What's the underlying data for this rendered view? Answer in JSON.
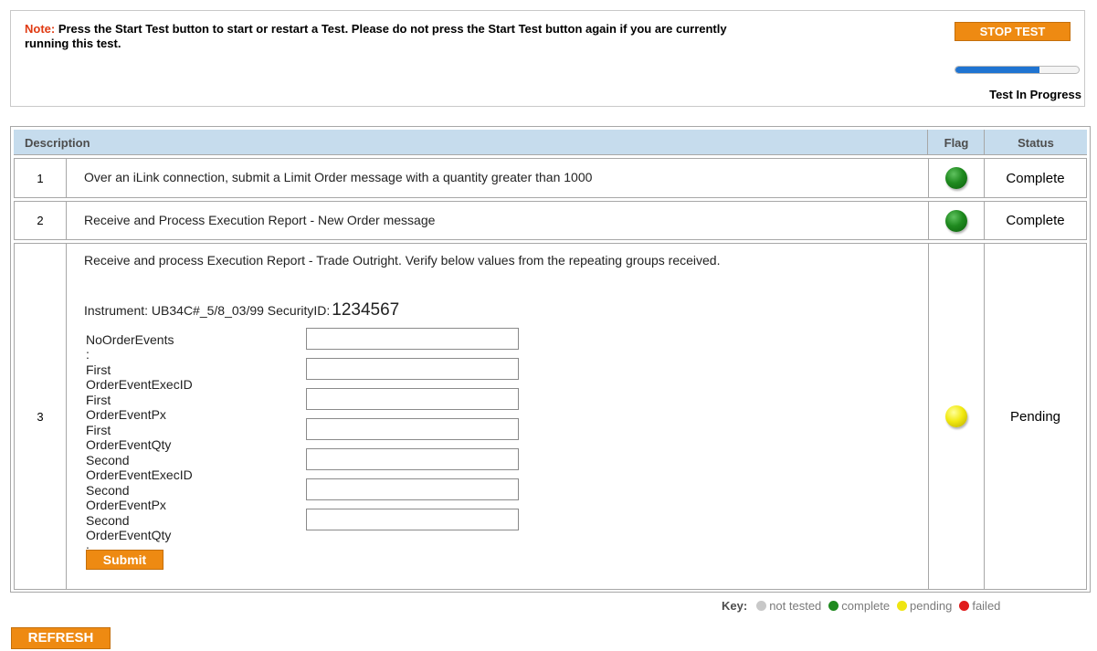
{
  "note": {
    "label": "Note:",
    "text": " Press the Start Test button to start or restart a Test. Please do not press the Start Test button again if you are currently running this test."
  },
  "stop_button": "STOP TEST",
  "progress": {
    "label": "Test In Progress",
    "fraction": 0.68,
    "color": "#1f74d1"
  },
  "table": {
    "headers": {
      "description": "Description",
      "flag": "Flag",
      "status": "Status"
    },
    "rows": [
      {
        "num": "1",
        "description": "Over an iLink connection, submit a Limit Order message with a quantity greater than 1000",
        "flag": "green",
        "status": "Complete"
      },
      {
        "num": "2",
        "description": "Receive and Process Execution Report - New Order message",
        "flag": "green",
        "status": "Complete"
      },
      {
        "num": "3",
        "description": "Receive and process Execution Report - Trade Outright. Verify below values from the repeating groups received.",
        "instrument_label": "Instrument: UB34C#_5/8_03/99 SecurityID:",
        "security_id": "1234567",
        "fields": [
          {
            "label": "NoOrderEvents :",
            "value": ""
          },
          {
            "label": "First OrderEventExecID :",
            "value": ""
          },
          {
            "label": "First OrderEventPx :",
            "value": ""
          },
          {
            "label": "First OrderEventQty :",
            "value": ""
          },
          {
            "label": "Second OrderEventExecID :",
            "value": ""
          },
          {
            "label": "Second OrderEventPx :",
            "value": ""
          },
          {
            "label": "Second OrderEventQty :",
            "value": ""
          }
        ],
        "submit_label": "Submit",
        "flag": "yellow",
        "status": "Pending"
      }
    ]
  },
  "key": {
    "title": "Key:",
    "items": [
      {
        "label": "not tested",
        "color": "#c8c8c8"
      },
      {
        "label": "complete",
        "color": "#1f8a1f"
      },
      {
        "label": "pending",
        "color": "#efe512"
      },
      {
        "label": "failed",
        "color": "#e01b1b"
      }
    ]
  },
  "refresh_button": "REFRESH",
  "colors": {
    "accent_orange": "#ee8a12",
    "header_blue": "#c6dced",
    "note_red": "#e03a12"
  }
}
